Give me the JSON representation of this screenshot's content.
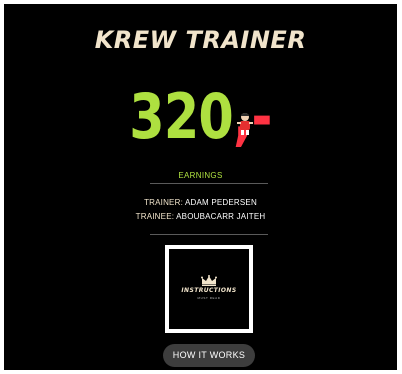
{
  "header": {
    "title": "KREW TRAINER"
  },
  "earnings": {
    "amount": "320",
    "suffix": ",-",
    "label": "EARNINGS"
  },
  "people": {
    "trainer_label": "TRAINER:",
    "trainer_name": "ADAM PEDERSEN",
    "trainee_label": "TRAINEE:",
    "trainee_name": "ABOUBACARR JAITEH"
  },
  "video": {
    "title": "INSTRUCTIONS",
    "subtitle": "MUST READ",
    "icon": "crown-icon"
  },
  "cta": {
    "label": "HOW IT WORKS"
  },
  "colors": {
    "background": "#000000",
    "accent_green": "#aee040",
    "accent_red": "#ff3343",
    "cream": "#f1e4cb",
    "button": "#3d3d3d"
  }
}
